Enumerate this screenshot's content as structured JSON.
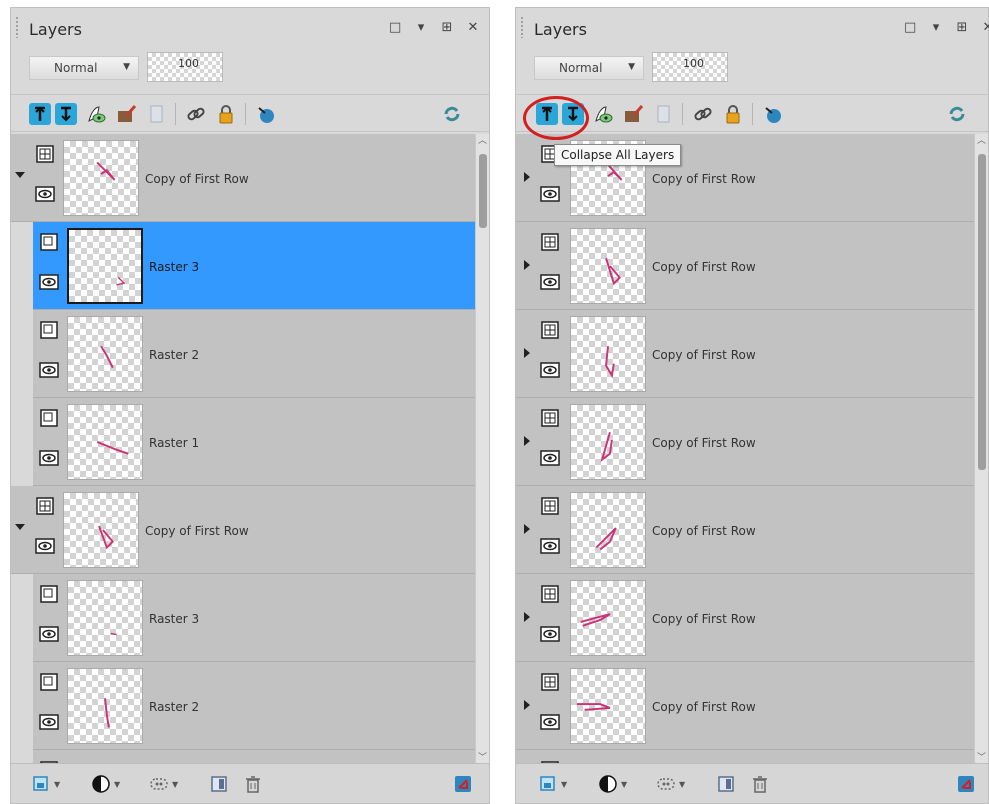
{
  "left_panel": {
    "title": "Layers",
    "window_buttons": [
      "□",
      "▾",
      "⊞",
      "✕"
    ],
    "blend_mode": "Normal",
    "opacity": "100",
    "layers": [
      {
        "name": "Copy of First Row",
        "type": "group",
        "expanded": true
      },
      {
        "name": "Raster 3",
        "type": "raster",
        "selected": true
      },
      {
        "name": "Raster 2",
        "type": "raster"
      },
      {
        "name": "Raster 1",
        "type": "raster"
      },
      {
        "name": "Copy of First Row",
        "type": "group",
        "expanded": true
      },
      {
        "name": "Raster 3",
        "type": "raster"
      },
      {
        "name": "Raster 2",
        "type": "raster"
      }
    ]
  },
  "right_panel": {
    "title": "Layers",
    "window_buttons": [
      "□",
      "▾",
      "⊞",
      "✕"
    ],
    "blend_mode": "Normal",
    "opacity": "100",
    "tooltip": "Collapse All Layers",
    "layers": [
      {
        "name": "Copy of First Row",
        "type": "group"
      },
      {
        "name": "Copy of First Row",
        "type": "group"
      },
      {
        "name": "Copy of First Row",
        "type": "group"
      },
      {
        "name": "Copy of First Row",
        "type": "group"
      },
      {
        "name": "Copy of First Row",
        "type": "group"
      },
      {
        "name": "Copy of First Row",
        "type": "group"
      },
      {
        "name": "Copy of First Row",
        "type": "group"
      }
    ]
  },
  "colors": {
    "selected_row": "#3399ff",
    "row_bg": "#c2c2c2",
    "stroke_pink": "#cc3377",
    "highlight_circle": "#d31f1f",
    "expand_button_blue": "#2aa6d8"
  },
  "icons": {
    "toolbar": [
      "expand-all-icon",
      "collapse-all-icon",
      "visibility-toggle-icon",
      "brush-icon",
      "mask-icon",
      "link-icon",
      "lock-icon",
      "properties-icon",
      "refresh-icon"
    ],
    "bottombar": [
      "new-layer-icon",
      "adjustment-layer-icon",
      "mask-layer-icon",
      "duplicate-icon",
      "delete-icon",
      "options-icon"
    ]
  }
}
